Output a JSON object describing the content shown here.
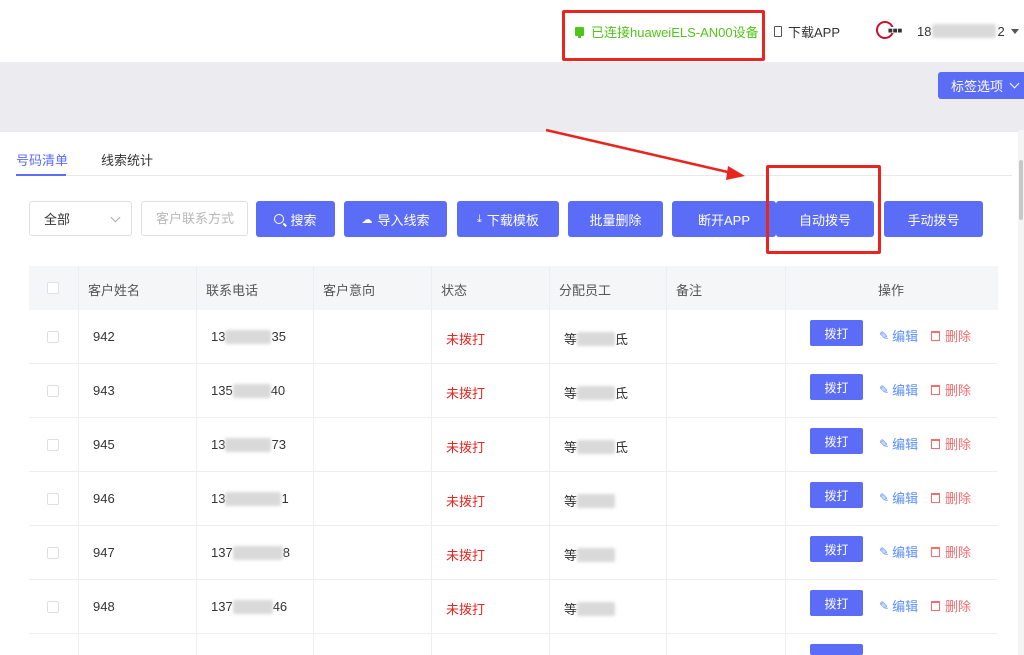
{
  "header": {
    "connection_status": "已连接huaweiELS-AN00设备",
    "download_app": "下载APP",
    "user_prefix": "18",
    "user_suffix": "2"
  },
  "toolbar": {
    "tag_options": "标签选项"
  },
  "tabs": [
    {
      "label": "号码清单",
      "active": true
    },
    {
      "label": "线索统计",
      "active": false
    }
  ],
  "filters": {
    "select_value": "全部",
    "contact_placeholder": "客户联系方式"
  },
  "actions": {
    "search": "搜索",
    "import": "导入线索",
    "download_template": "下载模板",
    "batch_delete": "批量删除",
    "disconnect_app": "断开APP",
    "auto_dial": "自动拨号",
    "manual_dial": "手动拨号"
  },
  "table": {
    "headers": [
      "客户姓名",
      "联系电话",
      "客户意向",
      "状态",
      "分配员工",
      "备注",
      "操作"
    ],
    "rows": [
      {
        "name": "942",
        "phone_prefix": "13",
        "phone_suffix": "35",
        "status": "未拨打",
        "staff_prefix": "等",
        "staff_suffix": "氐"
      },
      {
        "name": "943",
        "phone_prefix": "135",
        "phone_suffix": "40",
        "status": "未拨打",
        "staff_prefix": "等",
        "staff_suffix": "氐"
      },
      {
        "name": "945",
        "phone_prefix": "13",
        "phone_suffix": "73",
        "status": "未拨打",
        "staff_prefix": "等",
        "staff_suffix": "氐"
      },
      {
        "name": "946",
        "phone_prefix": "13",
        "phone_suffix": "1",
        "status": "未拨打",
        "staff_prefix": "等",
        "staff_suffix": ""
      },
      {
        "name": "947",
        "phone_prefix": "137",
        "phone_suffix": "8",
        "status": "未拨打",
        "staff_prefix": "等",
        "staff_suffix": ""
      },
      {
        "name": "948",
        "phone_prefix": "137",
        "phone_suffix": "46",
        "status": "未拨打",
        "staff_prefix": "等",
        "staff_suffix": ""
      }
    ],
    "dial_label": "拨打",
    "edit_label": "编辑",
    "delete_label": "删除"
  },
  "colors": {
    "primary": "#5b6cf7",
    "connected_green": "#52c41a",
    "status_red": "#e8251f",
    "annotation_red": "#e8251f"
  }
}
